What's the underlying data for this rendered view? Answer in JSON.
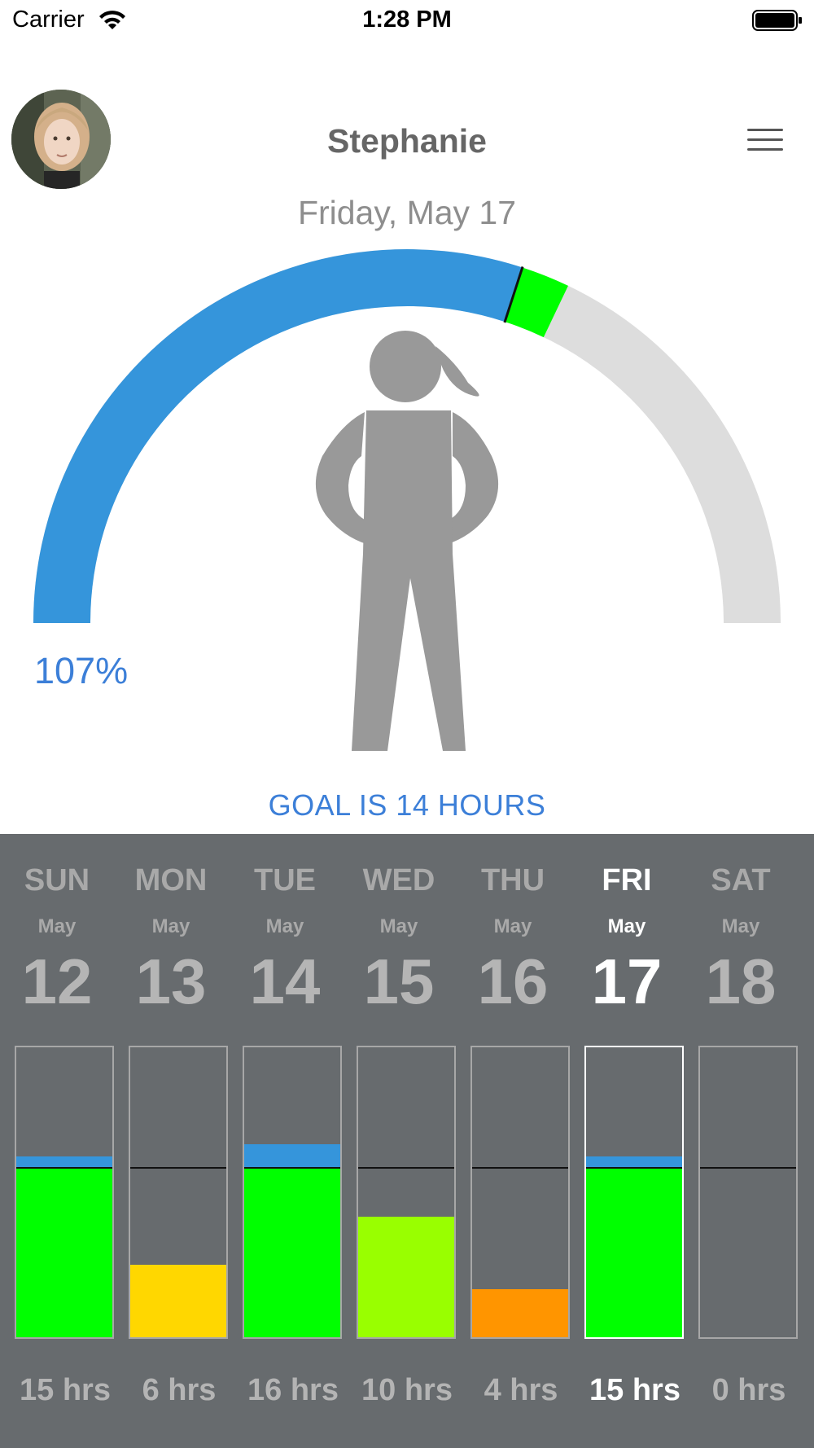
{
  "status_bar": {
    "carrier": "Carrier",
    "time": "1:28 PM",
    "wifi_icon": "wifi-icon",
    "battery_icon": "battery-full-icon"
  },
  "header": {
    "name": "Stephanie",
    "date": "Friday, May 17",
    "menu_icon": "hamburger-menu-icon",
    "avatar": "user-avatar-photo"
  },
  "gauge": {
    "percent_text": "107%",
    "percent_value": 1.07,
    "icon": "girl-figure-icon",
    "colors": {
      "progress": "#3595db",
      "over": "#00ff00",
      "remaining": "#dddddd",
      "figure": "#999999",
      "label": "#3c7fd8"
    }
  },
  "goal_text": "GOAL IS 14 HOURS",
  "goal_hours": 14,
  "week": {
    "days": [
      {
        "name": "SUN",
        "month": "May",
        "date": "12",
        "hours_text": "15 hrs",
        "hours": 15,
        "color": "#00ff00",
        "selected": false
      },
      {
        "name": "MON",
        "month": "May",
        "date": "13",
        "hours_text": "6 hrs",
        "hours": 6,
        "color": "#ffd700",
        "selected": false
      },
      {
        "name": "TUE",
        "month": "May",
        "date": "14",
        "hours_text": "16 hrs",
        "hours": 16,
        "color": "#00ff00",
        "selected": false
      },
      {
        "name": "WED",
        "month": "May",
        "date": "15",
        "hours_text": "10 hrs",
        "hours": 10,
        "color": "#99ff00",
        "selected": false
      },
      {
        "name": "THU",
        "month": "May",
        "date": "16",
        "hours_text": "4 hrs",
        "hours": 4,
        "color": "#ff9500",
        "selected": false
      },
      {
        "name": "FRI",
        "month": "May",
        "date": "17",
        "hours_text": "15 hrs",
        "hours": 15,
        "color": "#00ff00",
        "selected": true
      },
      {
        "name": "SAT",
        "month": "May",
        "date": "18",
        "hours_text": "0 hrs",
        "hours": 0,
        "color": "#00ff00",
        "selected": false
      }
    ],
    "colors": {
      "panel": "#676b6e",
      "over_goal": "#3595db"
    }
  }
}
